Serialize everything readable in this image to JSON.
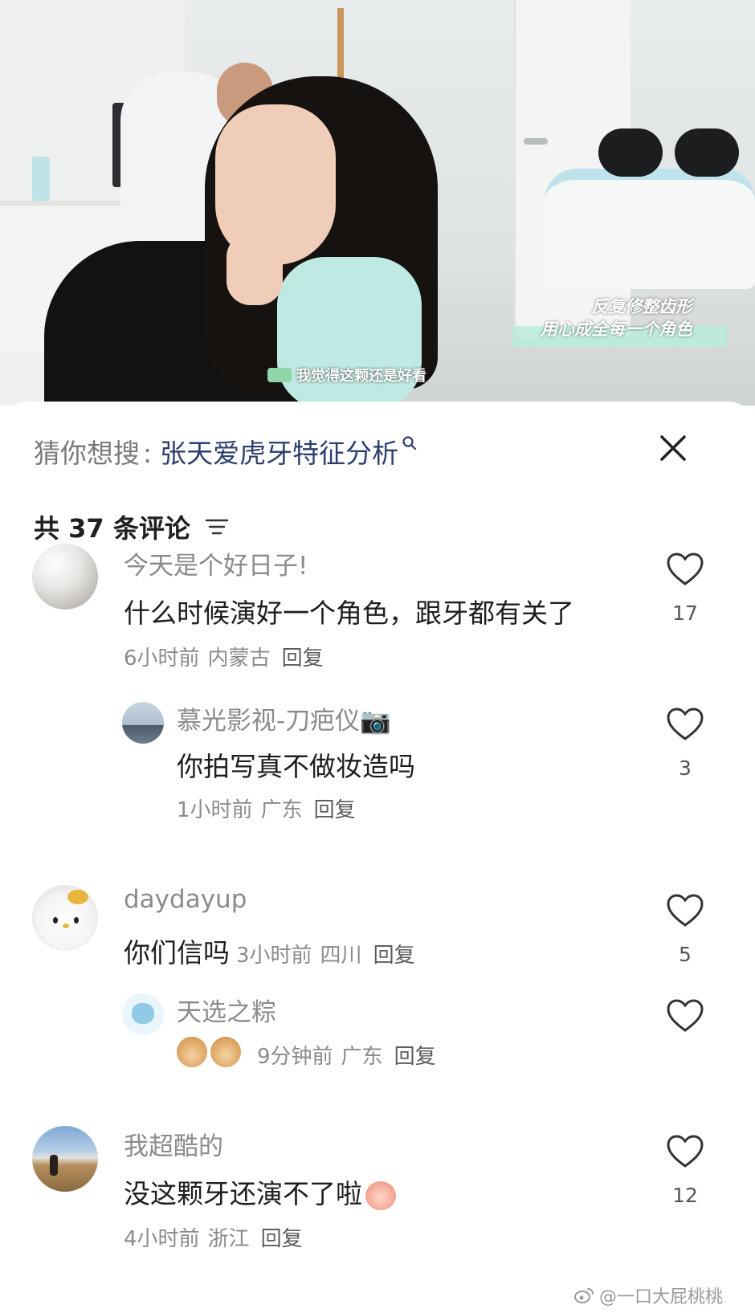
{
  "video": {
    "overlay_line1": "反复修整齿形",
    "overlay_line2": "用心成全每一个角色",
    "subtitle": "我觉得这颗还是好看"
  },
  "search": {
    "prefix": "猜你想搜",
    "colon": ":",
    "term": "张天爱虎牙特征分析"
  },
  "comments_header": {
    "count_label": "共 37 条评论"
  },
  "comments": [
    {
      "username": "今天是个好日子!",
      "content": "什么时候演好一个角色，跟牙都有关了",
      "time": "6小时前",
      "location": "内蒙古",
      "reply": "回复",
      "likes": "17",
      "avatar": "pearl-avatar"
    },
    {
      "username": "慕光影视-刀疤仪📷",
      "content": "你拍写真不做妆造吗",
      "time": "1小时前",
      "location": "广东",
      "reply": "回复",
      "likes": "3",
      "avatar": "boat-avatar"
    },
    {
      "username": "daydayup",
      "content": "你们信吗",
      "time": "3小时前",
      "location": "四川",
      "reply": "回复",
      "likes": "5",
      "avatar": "hello-kitty-avatar"
    },
    {
      "username": "天选之粽",
      "time": "9分钟前",
      "location": "广东",
      "reply": "回复",
      "avatar": "blue-cat-avatar"
    },
    {
      "username": "我超酷的",
      "content": "没这颗牙还演不了啦",
      "time": "4小时前",
      "location": "浙江",
      "reply": "回复",
      "likes": "12",
      "avatar": "landscape-avatar"
    }
  ],
  "watermark": "@一口大屁桃桃",
  "colors": {
    "search_term": "#2c3e6e",
    "muted_text": "#8b8b8b",
    "primary_text": "#1e1e1e"
  }
}
